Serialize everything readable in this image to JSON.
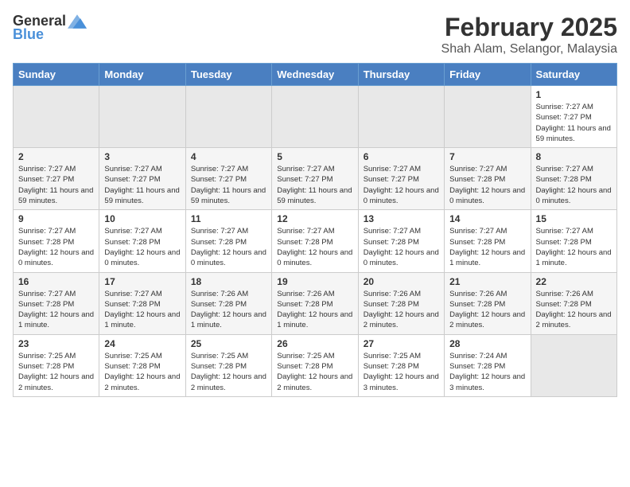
{
  "header": {
    "logo_general": "General",
    "logo_blue": "Blue",
    "title": "February 2025",
    "subtitle": "Shah Alam, Selangor, Malaysia"
  },
  "calendar": {
    "days_of_week": [
      "Sunday",
      "Monday",
      "Tuesday",
      "Wednesday",
      "Thursday",
      "Friday",
      "Saturday"
    ],
    "weeks": [
      {
        "days": [
          {
            "number": "",
            "empty": true
          },
          {
            "number": "",
            "empty": true
          },
          {
            "number": "",
            "empty": true
          },
          {
            "number": "",
            "empty": true
          },
          {
            "number": "",
            "empty": true
          },
          {
            "number": "",
            "empty": true
          },
          {
            "number": "1",
            "sunrise": "7:27 AM",
            "sunset": "7:27 PM",
            "daylight": "11 hours and 59 minutes."
          }
        ]
      },
      {
        "days": [
          {
            "number": "2",
            "sunrise": "7:27 AM",
            "sunset": "7:27 PM",
            "daylight": "11 hours and 59 minutes."
          },
          {
            "number": "3",
            "sunrise": "7:27 AM",
            "sunset": "7:27 PM",
            "daylight": "11 hours and 59 minutes."
          },
          {
            "number": "4",
            "sunrise": "7:27 AM",
            "sunset": "7:27 PM",
            "daylight": "11 hours and 59 minutes."
          },
          {
            "number": "5",
            "sunrise": "7:27 AM",
            "sunset": "7:27 PM",
            "daylight": "11 hours and 59 minutes."
          },
          {
            "number": "6",
            "sunrise": "7:27 AM",
            "sunset": "7:27 PM",
            "daylight": "12 hours and 0 minutes."
          },
          {
            "number": "7",
            "sunrise": "7:27 AM",
            "sunset": "7:28 PM",
            "daylight": "12 hours and 0 minutes."
          },
          {
            "number": "8",
            "sunrise": "7:27 AM",
            "sunset": "7:28 PM",
            "daylight": "12 hours and 0 minutes."
          }
        ]
      },
      {
        "days": [
          {
            "number": "9",
            "sunrise": "7:27 AM",
            "sunset": "7:28 PM",
            "daylight": "12 hours and 0 minutes."
          },
          {
            "number": "10",
            "sunrise": "7:27 AM",
            "sunset": "7:28 PM",
            "daylight": "12 hours and 0 minutes."
          },
          {
            "number": "11",
            "sunrise": "7:27 AM",
            "sunset": "7:28 PM",
            "daylight": "12 hours and 0 minutes."
          },
          {
            "number": "12",
            "sunrise": "7:27 AM",
            "sunset": "7:28 PM",
            "daylight": "12 hours and 0 minutes."
          },
          {
            "number": "13",
            "sunrise": "7:27 AM",
            "sunset": "7:28 PM",
            "daylight": "12 hours and 0 minutes."
          },
          {
            "number": "14",
            "sunrise": "7:27 AM",
            "sunset": "7:28 PM",
            "daylight": "12 hours and 1 minute."
          },
          {
            "number": "15",
            "sunrise": "7:27 AM",
            "sunset": "7:28 PM",
            "daylight": "12 hours and 1 minute."
          }
        ]
      },
      {
        "days": [
          {
            "number": "16",
            "sunrise": "7:27 AM",
            "sunset": "7:28 PM",
            "daylight": "12 hours and 1 minute."
          },
          {
            "number": "17",
            "sunrise": "7:27 AM",
            "sunset": "7:28 PM",
            "daylight": "12 hours and 1 minute."
          },
          {
            "number": "18",
            "sunrise": "7:26 AM",
            "sunset": "7:28 PM",
            "daylight": "12 hours and 1 minute."
          },
          {
            "number": "19",
            "sunrise": "7:26 AM",
            "sunset": "7:28 PM",
            "daylight": "12 hours and 1 minute."
          },
          {
            "number": "20",
            "sunrise": "7:26 AM",
            "sunset": "7:28 PM",
            "daylight": "12 hours and 2 minutes."
          },
          {
            "number": "21",
            "sunrise": "7:26 AM",
            "sunset": "7:28 PM",
            "daylight": "12 hours and 2 minutes."
          },
          {
            "number": "22",
            "sunrise": "7:26 AM",
            "sunset": "7:28 PM",
            "daylight": "12 hours and 2 minutes."
          }
        ]
      },
      {
        "days": [
          {
            "number": "23",
            "sunrise": "7:25 AM",
            "sunset": "7:28 PM",
            "daylight": "12 hours and 2 minutes."
          },
          {
            "number": "24",
            "sunrise": "7:25 AM",
            "sunset": "7:28 PM",
            "daylight": "12 hours and 2 minutes."
          },
          {
            "number": "25",
            "sunrise": "7:25 AM",
            "sunset": "7:28 PM",
            "daylight": "12 hours and 2 minutes."
          },
          {
            "number": "26",
            "sunrise": "7:25 AM",
            "sunset": "7:28 PM",
            "daylight": "12 hours and 2 minutes."
          },
          {
            "number": "27",
            "sunrise": "7:25 AM",
            "sunset": "7:28 PM",
            "daylight": "12 hours and 3 minutes."
          },
          {
            "number": "28",
            "sunrise": "7:24 AM",
            "sunset": "7:28 PM",
            "daylight": "12 hours and 3 minutes."
          },
          {
            "number": "",
            "empty": true
          }
        ]
      }
    ],
    "labels": {
      "sunrise": "Sunrise:",
      "sunset": "Sunset:",
      "daylight": "Daylight:"
    }
  }
}
